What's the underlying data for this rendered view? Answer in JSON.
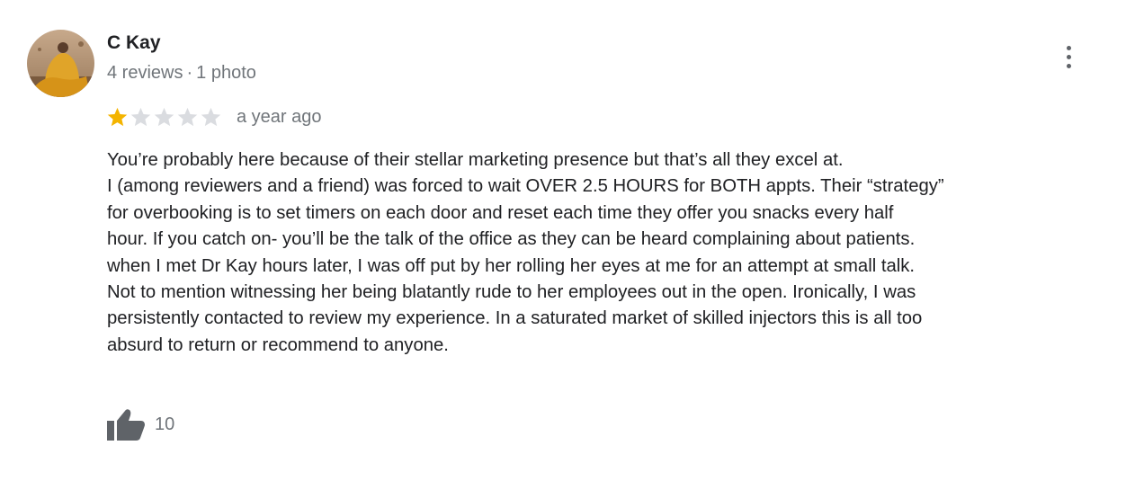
{
  "reviewer": {
    "name": "C Kay",
    "review_count": "4 reviews",
    "separator": "·",
    "photo_count": "1 photo"
  },
  "menu_icon": "more-vert-icon",
  "rating": {
    "stars": 1,
    "max_stars": 5,
    "filled_color": "#f4b400",
    "empty_color": "#dadce0",
    "date": "a year ago"
  },
  "review_lines": [
    "You’re probably here because of their stellar marketing presence but that’s all they excel at.",
    "I (among reviewers and a friend) was forced to wait OVER 2.5 HOURS for BOTH appts. Their “strategy”",
    "for overbooking is to set timers on each door and reset each time they offer you snacks every half",
    "hour. If you catch on- you’ll be the talk of the office as they can be heard complaining about patients.",
    "when I met Dr Kay hours later, I was off put by her rolling her eyes at me for an attempt at small talk.",
    "Not to mention witnessing her being blatantly rude to her employees out in the open. Ironically, I was",
    "persistently contacted to review my experience. In a saturated market of skilled injectors this is all too",
    "absurd to return or recommend to anyone."
  ],
  "likes": {
    "icon": "thumb-up-icon",
    "count": "10"
  }
}
